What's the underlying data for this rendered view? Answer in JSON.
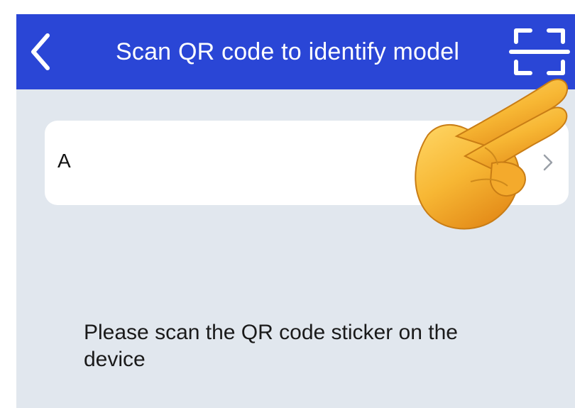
{
  "header": {
    "title": "Scan QR code to identify model",
    "back_icon": "chevron-left-icon",
    "scan_icon": "scan-frame-icon",
    "background_color": "#2a46d6"
  },
  "model_card": {
    "label": "A",
    "chevron_icon": "chevron-right-icon"
  },
  "instruction": {
    "text": "Please scan the QR code sticker on the device"
  },
  "overlay": {
    "pointer_icon": "pointing-hand-icon"
  },
  "colors": {
    "page_background": "#e1e7ee",
    "card_background": "#ffffff",
    "header_text": "#ffffff"
  }
}
